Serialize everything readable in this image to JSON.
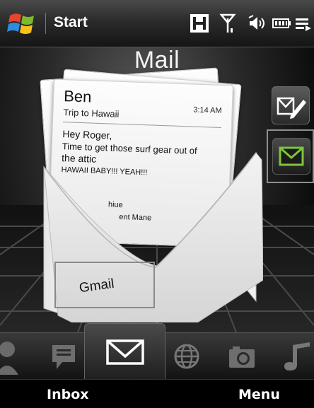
{
  "statusbar": {
    "start_label": "Start",
    "icons": [
      "windows-logo",
      "h-signal-icon",
      "antenna-icon",
      "speaker-icon",
      "battery-icon",
      "menu-lines-icon"
    ]
  },
  "screen": {
    "title": "Mail"
  },
  "message": {
    "sender": "Ben",
    "subject": "Trip to Hawaii",
    "time": "3:14 AM",
    "body_lines": [
      "Hey Roger,",
      "Time to get those surf gear out of",
      "the attic",
      "HAWAII BABY!!! YEAH!!!"
    ],
    "partial_lines": [
      "hiue",
      "ent Mane"
    ]
  },
  "account": {
    "label": "Gmail"
  },
  "side_buttons": [
    "compose-icon",
    "inbox-icon"
  ],
  "tabs": [
    "people-icon",
    "messaging-icon",
    "mail-icon",
    "internet-icon",
    "camera-icon",
    "music-icon"
  ],
  "selected_tab": "mail-icon",
  "softkeys": {
    "left": "Inbox",
    "right": "Menu"
  },
  "colors": {
    "accent_green": "#7fc43a",
    "background": "#000000"
  }
}
